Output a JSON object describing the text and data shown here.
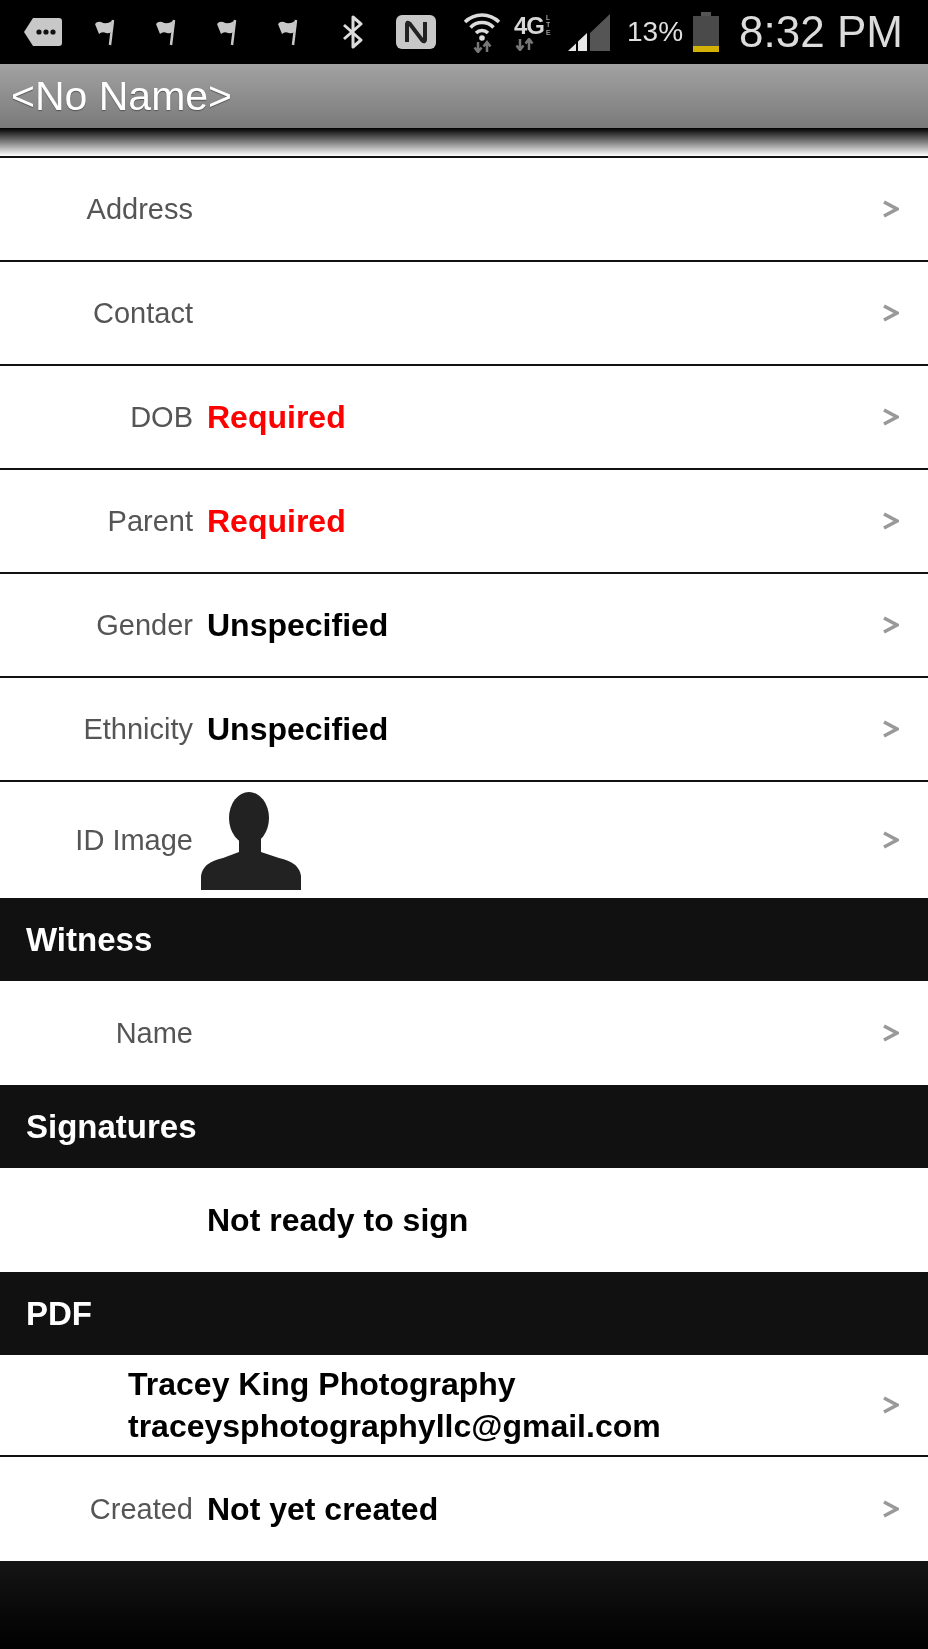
{
  "status_bar": {
    "network": "4G",
    "network_sub": "LTE",
    "battery": "13%",
    "time": "8:32 PM"
  },
  "title": "<No Name>",
  "sections": [
    {
      "rows": [
        {
          "kind": "field",
          "label": "Address",
          "navigable": true
        },
        {
          "kind": "field",
          "label": "Contact",
          "navigable": true
        },
        {
          "kind": "field",
          "label": "DOB",
          "value": "Required",
          "error": true,
          "navigable": true
        },
        {
          "kind": "field",
          "label": "Parent",
          "value": "Required",
          "error": true,
          "navigable": true
        },
        {
          "kind": "field",
          "label": "Gender",
          "value": "Unspecified",
          "error": false,
          "navigable": true
        },
        {
          "kind": "field",
          "label": "Ethnicity",
          "value": "Unspecified",
          "error": false,
          "navigable": true
        },
        {
          "kind": "image",
          "label": "ID Image",
          "navigable": true
        }
      ]
    },
    {
      "title": "Witness",
      "rows": [
        {
          "kind": "field",
          "label": "Name",
          "navigable": true
        }
      ]
    },
    {
      "title": "Signatures",
      "rows": [
        {
          "kind": "field",
          "value": "Not ready to sign",
          "error": false,
          "navigable": false
        }
      ]
    },
    {
      "title": "PDF",
      "rows": [
        {
          "kind": "contact",
          "name": "Tracey King Photography",
          "email": "traceysphotographyllc@gmail.com",
          "navigable": true
        },
        {
          "kind": "field",
          "label": "Created",
          "value": "Not yet created",
          "error": false,
          "navigable": true
        }
      ]
    }
  ]
}
